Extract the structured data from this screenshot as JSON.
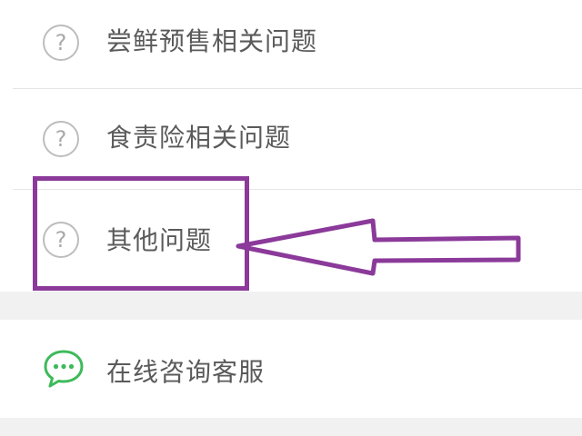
{
  "menu": {
    "items": [
      {
        "label": "尝鲜预售相关问题",
        "icon": "question-circle-icon"
      },
      {
        "label": "食责险相关问题",
        "icon": "question-circle-icon"
      },
      {
        "label": "其他问题",
        "icon": "question-circle-icon"
      }
    ],
    "question_glyph": "?",
    "customer_service": {
      "label": "在线咨询客服",
      "icon": "chat-bubble-icon"
    }
  },
  "colors": {
    "highlight": "#8b3a9a",
    "chat_icon": "#3dba5a",
    "label_text": "#5a5a5a",
    "divider": "#e6e6e6",
    "section_gap": "#f1f1f1"
  }
}
